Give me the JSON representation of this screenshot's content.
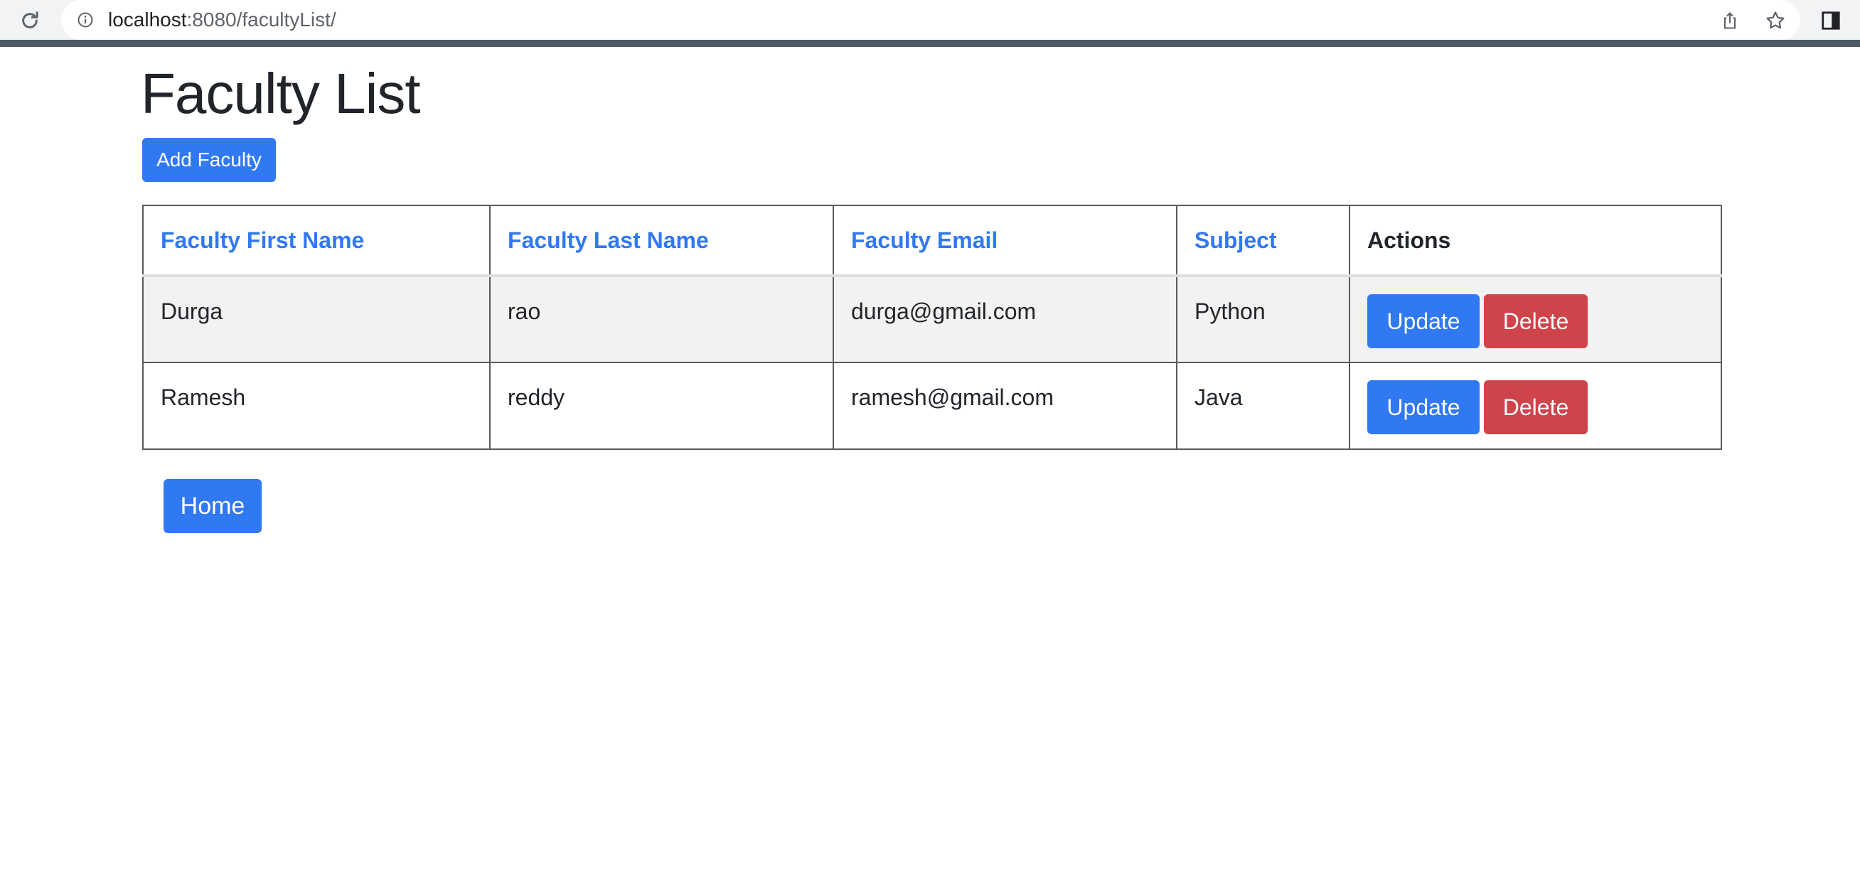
{
  "browser": {
    "url_host": "localhost",
    "url_path": ":8080/facultyList/"
  },
  "page": {
    "title": "Faculty List",
    "add_button_label": "Add Faculty",
    "home_button_label": "Home"
  },
  "table": {
    "columns": [
      "Faculty First Name",
      "Faculty Last Name",
      "Faculty Email",
      "Subject",
      "Actions"
    ],
    "rows": [
      {
        "first_name": "Durga",
        "last_name": "rao",
        "email": "durga@gmail.com",
        "subject": "Python",
        "update_label": "Update",
        "delete_label": "Delete"
      },
      {
        "first_name": "Ramesh",
        "last_name": "reddy",
        "email": "ramesh@gmail.com",
        "subject": "Java",
        "update_label": "Update",
        "delete_label": "Delete"
      }
    ]
  },
  "colors": {
    "primary": "#3179f2",
    "danger": "#cf444b",
    "stripe": "#f2f2f2"
  },
  "icons": [
    "reload-icon",
    "info-icon",
    "share-icon",
    "star-icon",
    "sidepanel-icon"
  ]
}
